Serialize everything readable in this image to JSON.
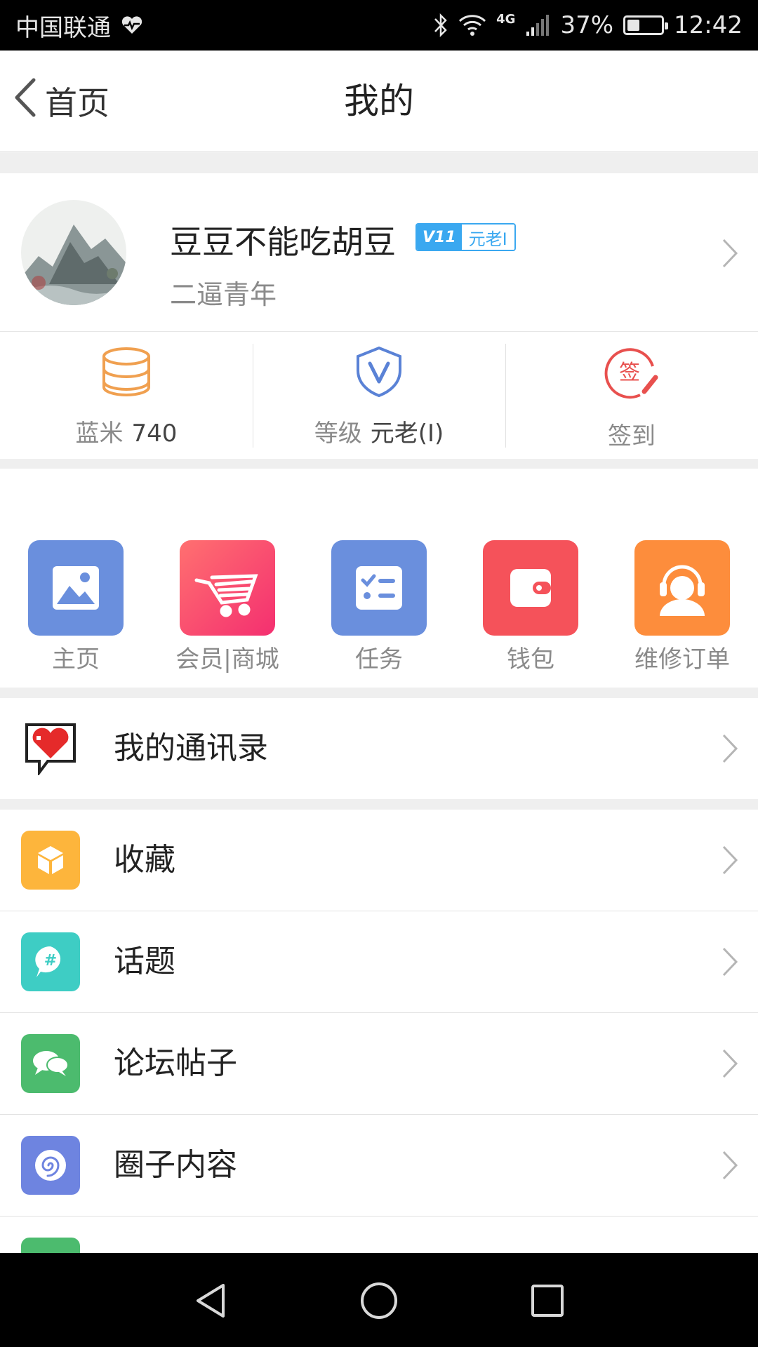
{
  "status_bar": {
    "carrier": "中国联通",
    "network": "4G",
    "battery": "37%",
    "battery_level": 0.37,
    "time": "12:42"
  },
  "header": {
    "back_label": "首页",
    "title": "我的"
  },
  "profile": {
    "name": "豆豆不能吃胡豆",
    "badge_level_icon": "V11",
    "badge_text": "元老I",
    "subtitle": "二逼青年"
  },
  "stats": [
    {
      "label": "蓝米",
      "value": "740",
      "icon": "coins-icon"
    },
    {
      "label": "等级",
      "value": "元老(I)",
      "icon": "shield-v-icon"
    },
    {
      "label": "签到",
      "value": "",
      "icon": "sign-in-icon"
    }
  ],
  "quick_links": [
    {
      "label": "主页",
      "icon": "image-icon",
      "color": "#6a8fdd"
    },
    {
      "label": "会员|商城",
      "icon": "cart-icon",
      "color": "#f8566a"
    },
    {
      "label": "任务",
      "icon": "task-list-icon",
      "color": "#6a8fdd"
    },
    {
      "label": "钱包",
      "icon": "wallet-icon",
      "color": "#f5525a"
    },
    {
      "label": "维修订单",
      "icon": "headset-person-icon",
      "color": "#fd8d3c"
    }
  ],
  "contacts_item": {
    "label": "我的通讯录",
    "icon": "heart-bubble-icon"
  },
  "menu_items": [
    {
      "label": "收藏",
      "icon": "box-icon",
      "color": "#fdb53c"
    },
    {
      "label": "话题",
      "icon": "hashtag-bubble-icon",
      "color": "#3ecdc4"
    },
    {
      "label": "论坛帖子",
      "icon": "chat-bubbles-icon",
      "color": "#4cbb6e"
    },
    {
      "label": "圈子内容",
      "icon": "spiral-icon",
      "color": "#6e84e0"
    }
  ],
  "colors": {
    "accent_blue": "#3aa8f0",
    "orange": "#f0a050",
    "red": "#e8504e"
  }
}
